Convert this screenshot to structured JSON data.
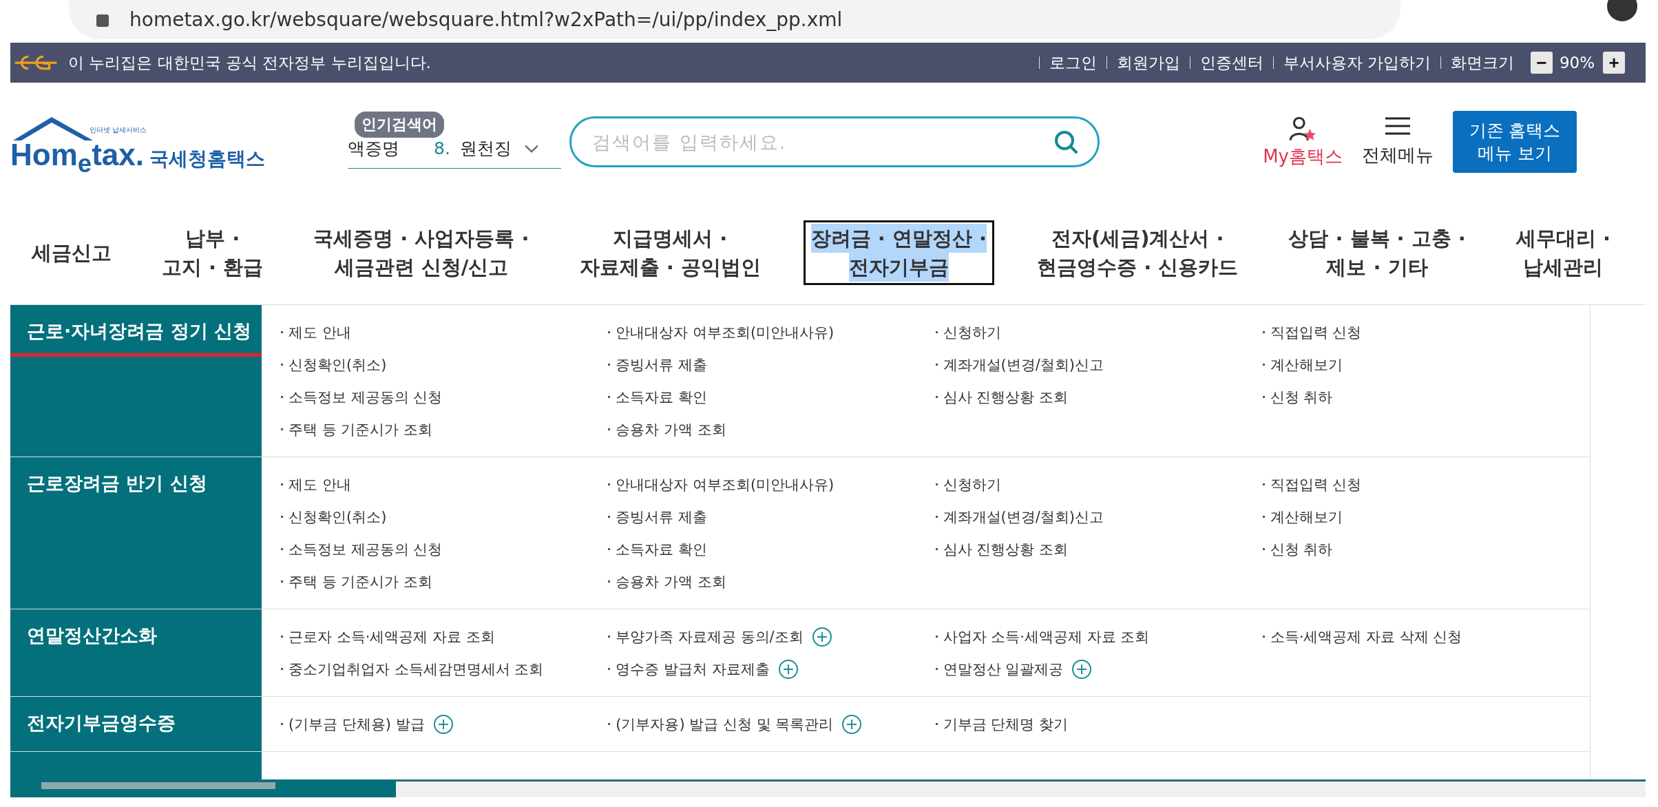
{
  "browser": {
    "url": "hometax.go.kr/websquare/websquare.html?w2xPath=/ui/pp/index_pp.xml"
  },
  "gov_bar": {
    "notice": "이 누리집은 대한민국 공식 전자정부 누리집입니다.",
    "links": [
      "로그인",
      "회원가입",
      "인증센터",
      "부서사용자 가입하기"
    ],
    "zoom_label": "화면크기",
    "zoom_out": "−",
    "zoom_value": "90%",
    "zoom_in": "+"
  },
  "header": {
    "logo_tagline": "인터넷 납세서비스",
    "logo_brand": "Hom$_{e}$tax.",
    "logo_name": "국세청홈택스",
    "popular_badge": "인기검색어",
    "popular_prev": "액증명",
    "popular_rank": "8.",
    "popular_term": "원천징",
    "search": {
      "placeholder": "검색어를 입력하세요."
    },
    "my_label": "My홈택스",
    "menu_label": "전체메뉴",
    "legacy_button": [
      "기존 홈택스",
      "메뉴 보기"
    ]
  },
  "nav": [
    {
      "lines": [
        "세금신고"
      ],
      "selected": false
    },
    {
      "lines": [
        "납부 ·",
        "고지 · 환급"
      ],
      "selected": false
    },
    {
      "lines": [
        "국세증명 · 사업자등록 ·",
        "세금관련 신청/신고"
      ],
      "selected": false
    },
    {
      "lines": [
        "지급명세서 ·",
        "자료제출 · 공익법인"
      ],
      "selected": false
    },
    {
      "lines": [
        "장려금 · 연말정산 ·",
        "전자기부금"
      ],
      "selected": true
    },
    {
      "lines": [
        "전자(세금)계산서 ·",
        "현금영수증 · 신용카드"
      ],
      "selected": false
    },
    {
      "lines": [
        "상담 · 불복 · 고충 ·",
        "제보 · 기타"
      ],
      "selected": false
    },
    {
      "lines": [
        "세무대리 ·",
        "납세관리"
      ],
      "selected": false
    }
  ],
  "sections": [
    {
      "title": "근로·자녀장려금 정기 신청",
      "selected": true,
      "items": [
        {
          "text": "제도 안내",
          "expandable": false
        },
        {
          "text": "안내대상자 여부조회(미안내사유)",
          "expandable": false
        },
        {
          "text": "신청하기",
          "expandable": false
        },
        {
          "text": "직접입력 신청",
          "expandable": false
        },
        {
          "text": "신청확인(취소)",
          "expandable": false
        },
        {
          "text": "증빙서류 제출",
          "expandable": false
        },
        {
          "text": "계좌개설(변경/철회)신고",
          "expandable": false
        },
        {
          "text": "계산해보기",
          "expandable": false
        },
        {
          "text": "소득정보 제공동의 신청",
          "expandable": false
        },
        {
          "text": "소득자료 확인",
          "expandable": false
        },
        {
          "text": "심사 진행상황 조회",
          "expandable": false
        },
        {
          "text": "신청 취하",
          "expandable": false
        },
        {
          "text": "주택 등 기준시가 조회",
          "expandable": false
        },
        {
          "text": "승용차 가액 조회",
          "expandable": false
        }
      ]
    },
    {
      "title": "근로장려금 반기 신청",
      "selected": false,
      "items": [
        {
          "text": "제도 안내",
          "expandable": false
        },
        {
          "text": "안내대상자 여부조회(미안내사유)",
          "expandable": false
        },
        {
          "text": "신청하기",
          "expandable": false
        },
        {
          "text": "직접입력 신청",
          "expandable": false
        },
        {
          "text": "신청확인(취소)",
          "expandable": false
        },
        {
          "text": "증빙서류 제출",
          "expandable": false
        },
        {
          "text": "계좌개설(변경/철회)신고",
          "expandable": false
        },
        {
          "text": "계산해보기",
          "expandable": false
        },
        {
          "text": "소득정보 제공동의 신청",
          "expandable": false
        },
        {
          "text": "소득자료 확인",
          "expandable": false
        },
        {
          "text": "심사 진행상황 조회",
          "expandable": false
        },
        {
          "text": "신청 취하",
          "expandable": false
        },
        {
          "text": "주택 등 기준시가 조회",
          "expandable": false
        },
        {
          "text": "승용차 가액 조회",
          "expandable": false
        }
      ]
    },
    {
      "title": "연말정산간소화",
      "selected": false,
      "items": [
        {
          "text": "근로자 소득·세액공제 자료 조회",
          "expandable": false
        },
        {
          "text": "부양가족 자료제공 동의/조회",
          "expandable": true
        },
        {
          "text": "사업자 소득·세액공제 자료 조회",
          "expandable": false
        },
        {
          "text": "소득·세액공제 자료 삭제 신청",
          "expandable": false
        },
        {
          "text": "중소기업취업자 소득세감면명세서 조회",
          "expandable": false
        },
        {
          "text": "영수증 발급처 자료제출",
          "expandable": true
        },
        {
          "text": "연말정산 일괄제공",
          "expandable": true
        }
      ]
    },
    {
      "title": "전자기부금영수증",
      "selected": false,
      "items": [
        {
          "text": "(기부금 단체용) 발급",
          "expandable": true
        },
        {
          "text": "(기부자용) 발급 신청 및 목록관리",
          "expandable": true
        },
        {
          "text": "기부금 단체명 찾기",
          "expandable": false
        }
      ]
    }
  ]
}
